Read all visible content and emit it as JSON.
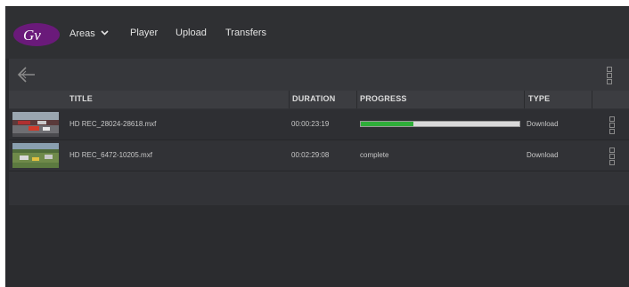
{
  "nav": {
    "logo_text": "Gv",
    "items": [
      {
        "label": "Areas"
      },
      {
        "label": "Player"
      },
      {
        "label": "Upload"
      },
      {
        "label": "Transfers"
      }
    ]
  },
  "table": {
    "columns": [
      "TITLE",
      "DURATION",
      "PROGRESS",
      "TYPE"
    ],
    "rows": [
      {
        "title": "HD REC_28024-28618.mxf",
        "duration": "00:00:23:19",
        "progress_fraction": 0.33,
        "progress_text": "",
        "type": "Download"
      },
      {
        "title": "HD REC_6472-10205.mxf",
        "duration": "00:02:29:08",
        "progress_fraction": 1.0,
        "progress_text": "complete",
        "type": "Download"
      }
    ]
  },
  "colors": {
    "logo": "#6a1a7a",
    "progress": "#2fae3a",
    "background": "#2a2b2e"
  },
  "icons": [
    "chevron-down-icon",
    "back-arrow-icon",
    "kebab-menu-icon"
  ]
}
